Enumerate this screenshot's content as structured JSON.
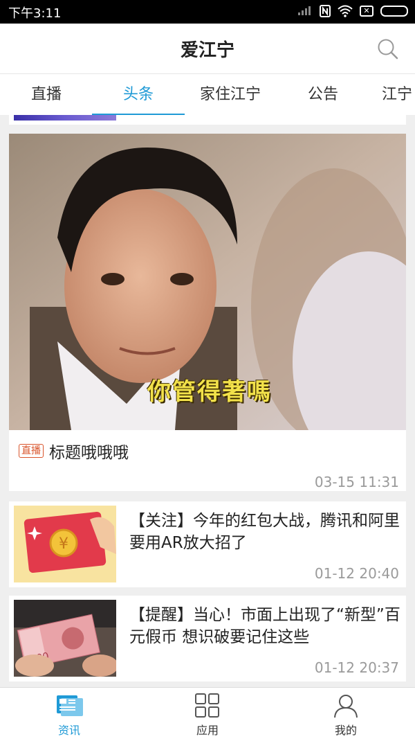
{
  "status_bar": {
    "time": "下午3:11",
    "icons": [
      "signal-off-icon",
      "nfc-icon",
      "wifi-icon",
      "sim-x-icon",
      "battery-icon"
    ]
  },
  "header": {
    "title": "爱江宁",
    "search_icon": "search-icon"
  },
  "tabs": [
    {
      "label": "直播",
      "active": false
    },
    {
      "label": "头条",
      "active": true
    },
    {
      "label": "家住江宁",
      "active": false
    },
    {
      "label": "公告",
      "active": false
    },
    {
      "label": "江宁",
      "active": false
    }
  ],
  "hero": {
    "badge": "直播",
    "title": "标题哦哦哦",
    "time": "03-15 11:31",
    "image_caption": "你管得著嗎"
  },
  "news": [
    {
      "title": "【关注】今年的红包大战，腾讯和阿里要用AR放大招了",
      "time": "01-12 20:40",
      "thumb_icon": "red-envelope-icon"
    },
    {
      "title": "【提醒】当心！市面上出现了“新型”百元假币 想识破要记住这些",
      "time": "01-12 20:37",
      "thumb_icon": "banknote-icon"
    }
  ],
  "bottom_nav": [
    {
      "label": "资讯",
      "icon": "news-icon",
      "active": true
    },
    {
      "label": "应用",
      "icon": "apps-grid-icon",
      "active": false
    },
    {
      "label": "我的",
      "icon": "profile-icon",
      "active": false
    }
  ],
  "colors": {
    "accent": "#1f9ad6",
    "badge": "#d9542b",
    "timestamp": "#9a9a9a",
    "background": "#efefef"
  }
}
